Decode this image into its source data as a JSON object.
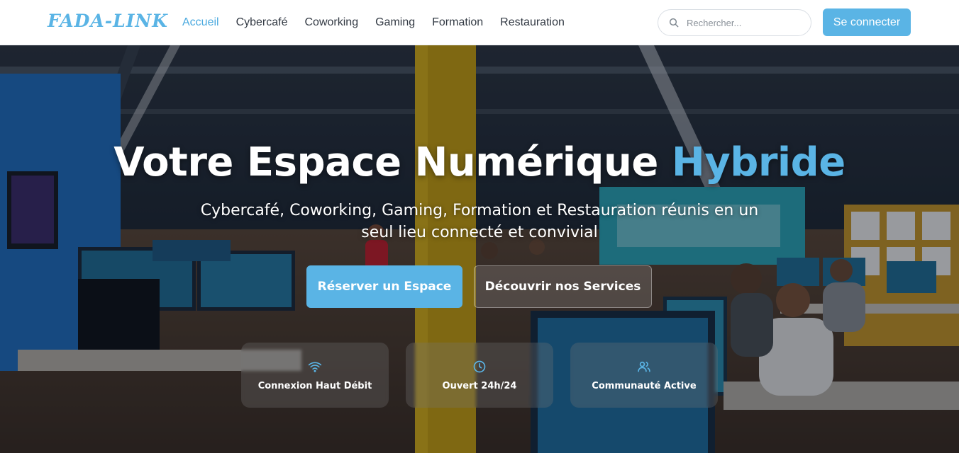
{
  "header": {
    "logo": "FADA-LINK",
    "nav": [
      {
        "label": "Accueil",
        "active": true
      },
      {
        "label": "Cybercafé",
        "active": false
      },
      {
        "label": "Coworking",
        "active": false
      },
      {
        "label": "Gaming",
        "active": false
      },
      {
        "label": "Formation",
        "active": false
      },
      {
        "label": "Restauration",
        "active": false
      }
    ],
    "search_placeholder": "Rechercher...",
    "login_label": "Se connecter"
  },
  "hero": {
    "title_main": "Votre Espace Numérique ",
    "title_accent": "Hybride",
    "subtitle": "Cybercafé, Coworking, Gaming, Formation et Restauration réunis en un seul lieu connecté et convivial",
    "primary_cta": "Réserver un Espace",
    "secondary_cta": "Découvrir nos Services",
    "features": [
      {
        "icon": "wifi-icon",
        "label": "Connexion Haut Débit"
      },
      {
        "icon": "clock-icon",
        "label": "Ouvert 24h/24"
      },
      {
        "icon": "users-icon",
        "label": "Communauté Active"
      }
    ]
  },
  "colors": {
    "accent": "#5ab4e5",
    "nav_text": "#333a44",
    "white": "#ffffff"
  }
}
